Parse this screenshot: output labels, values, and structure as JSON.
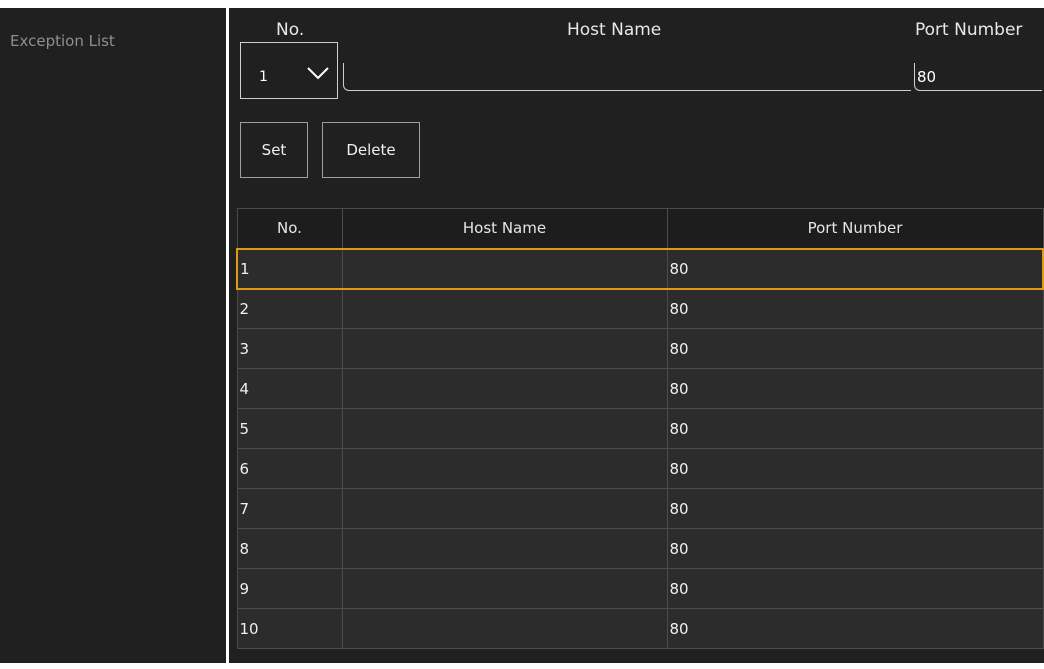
{
  "section": {
    "label": "Exception List"
  },
  "form": {
    "no_label": "No.",
    "host_label": "Host Name",
    "port_label": "Port Number",
    "no_value": "1",
    "host_value": "",
    "port_value": "80"
  },
  "buttons": {
    "set": "Set",
    "delete": "Delete"
  },
  "table": {
    "headers": [
      "No.",
      "Host Name",
      "Port Number"
    ],
    "selected_row": 1,
    "rows": [
      {
        "no": "1",
        "host": "",
        "port": "80"
      },
      {
        "no": "2",
        "host": "",
        "port": "80"
      },
      {
        "no": "3",
        "host": "",
        "port": "80"
      },
      {
        "no": "4",
        "host": "",
        "port": "80"
      },
      {
        "no": "5",
        "host": "",
        "port": "80"
      },
      {
        "no": "6",
        "host": "",
        "port": "80"
      },
      {
        "no": "7",
        "host": "",
        "port": "80"
      },
      {
        "no": "8",
        "host": "",
        "port": "80"
      },
      {
        "no": "9",
        "host": "",
        "port": "80"
      },
      {
        "no": "10",
        "host": "",
        "port": "80"
      }
    ]
  },
  "colors": {
    "background": "#202020",
    "row_background": "#2c2c2c",
    "selection_border": "#e09a16",
    "label_muted": "#8f8f8f"
  },
  "icons": {
    "dropdown": "chevron-down-icon"
  }
}
